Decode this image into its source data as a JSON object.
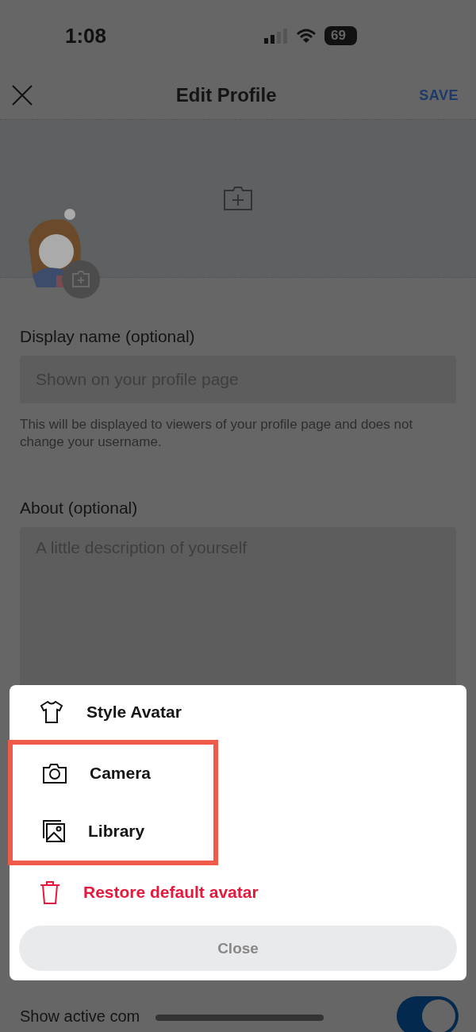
{
  "status_bar": {
    "time": "1:08",
    "battery": "69"
  },
  "header": {
    "title": "Edit Profile",
    "action": "SAVE"
  },
  "form": {
    "display_name": {
      "label": "Display name (optional)",
      "placeholder": "Shown on your profile page",
      "help": "This will be displayed to viewers of your profile page and does not change your username."
    },
    "about": {
      "label": "About (optional)",
      "placeholder": "A little description of yourself"
    },
    "toggle": {
      "label": "Show active com",
      "on": true
    }
  },
  "sheet": {
    "items": [
      {
        "kind": "shirt",
        "label": "Style Avatar",
        "danger": false,
        "highlighted": false
      },
      {
        "kind": "camera",
        "label": "Camera",
        "danger": false,
        "highlighted": true
      },
      {
        "kind": "library",
        "label": "Library",
        "danger": false,
        "highlighted": true
      },
      {
        "kind": "trash",
        "label": "Restore default avatar",
        "danger": true,
        "highlighted": false
      }
    ],
    "close": "Close"
  }
}
